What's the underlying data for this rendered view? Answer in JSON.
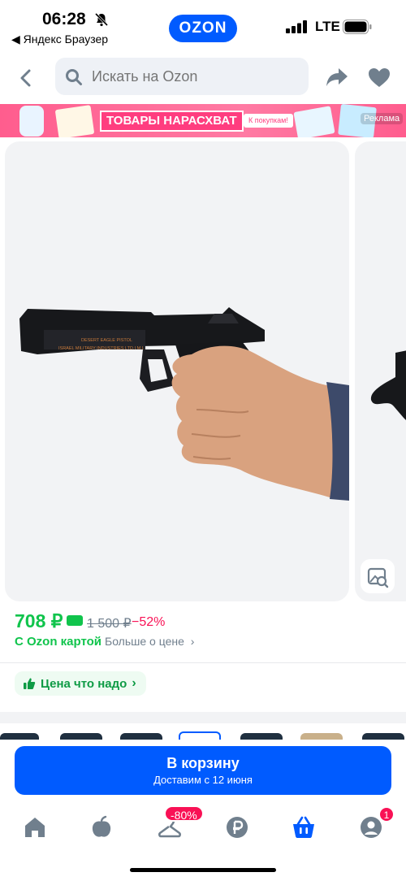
{
  "status_bar": {
    "time": "06:28",
    "back_app": "◀ Яндекс Браузер",
    "logo": "OZON",
    "network": "LTE"
  },
  "search": {
    "placeholder": "Искать на Ozon"
  },
  "banner": {
    "title": "ТОВАРЫ НАРАСХВАТ",
    "cta": "К покупкам!",
    "ad_label": "Реклама"
  },
  "product": {
    "price": "708 ₽",
    "old_price": "1 500 ₽",
    "discount": "−52%",
    "ozon_card": "С Ozon картой",
    "more_price": "Больше о цене",
    "good_price": "Цена что надо",
    "gun_engraving_1": "DESERT EAGLE PISTOL",
    "gun_engraving_2": "ISRAEL MILITARY INDUSTRIES LTD.I.M.I."
  },
  "cart": {
    "label": "В корзину",
    "delivery": "Доставим с 12 июня"
  },
  "tabs": {
    "sale_badge": "-80%",
    "profile_badge": "1"
  },
  "colors": {
    "brand": "#005bff",
    "price_green": "#10c44c",
    "accent_pink": "#f91155"
  }
}
